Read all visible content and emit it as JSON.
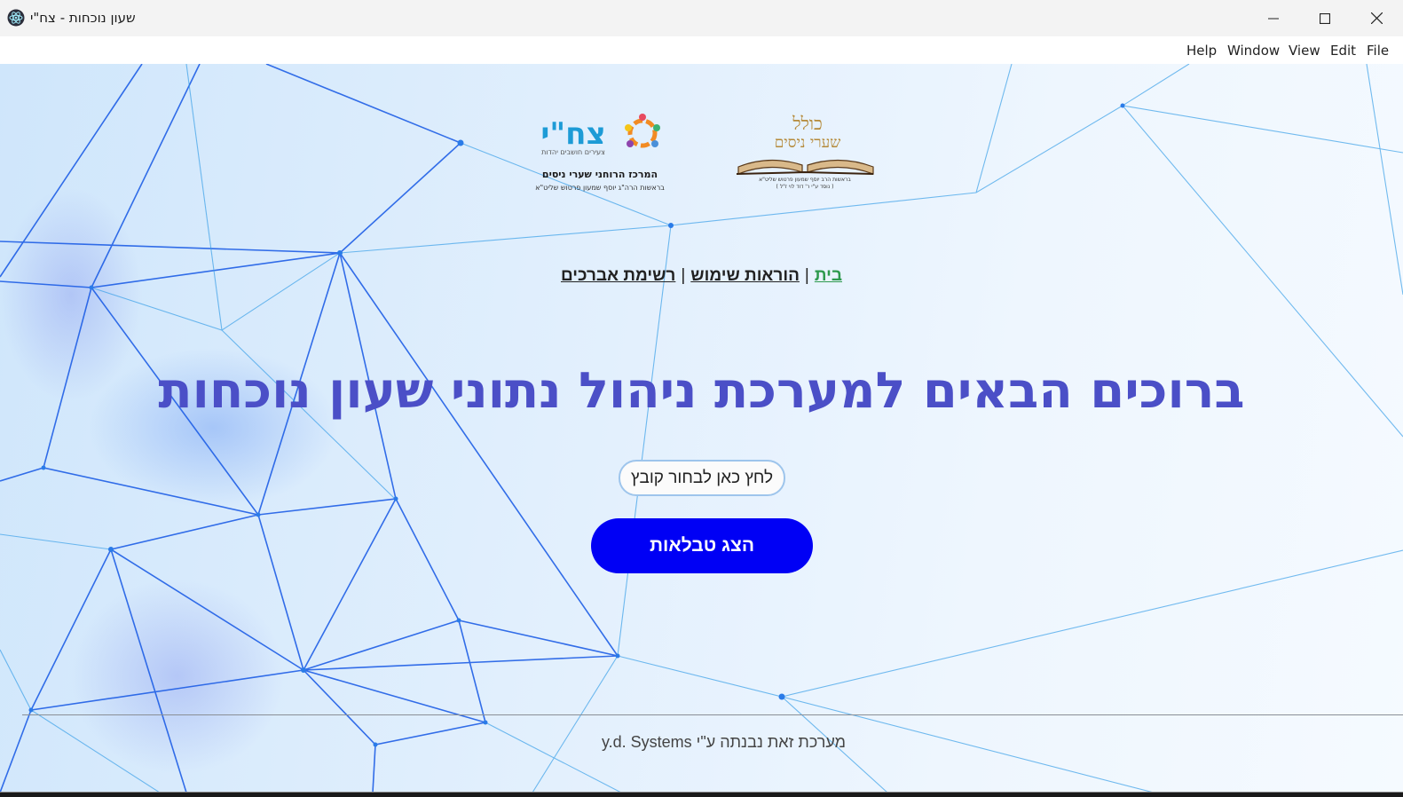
{
  "window": {
    "title": "שעון נוכחות - צח\"י",
    "controls": {
      "minimize": "minimize-icon",
      "maximize": "maximize-icon",
      "close": "close-icon"
    }
  },
  "menu": {
    "file": "File",
    "edit": "Edit",
    "view": "View",
    "window": "Window",
    "help": "Help"
  },
  "logos": {
    "left": {
      "brand": "צח\"י",
      "tagline": "צעירים חושבים יהדות",
      "line1": "המרכז הרוחני שערי ניסים",
      "line2": "בראשות הרה\"ג יוסף שמעון פרטוש שליט\"א"
    },
    "right": {
      "line1": "כולל",
      "line2": "שערי ניסים",
      "line3": "בראשות הרב יוסף שמעון פרטוש שליט\"א",
      "line4": "( נוסד ע\"י ר' דוד לוי ז\"ל )"
    }
  },
  "nav": {
    "home": "בית",
    "instructions": "הוראות שימוש",
    "list": "רשימת אברכים",
    "separator": "|"
  },
  "heading": "ברוכים הבאים למערכת ניהול נתוני שעון נוכחות",
  "buttons": {
    "choose_file": "לחץ כאן לבחור קובץ",
    "show_tables": "הצג טבלאות"
  },
  "footer": "מערכת זאת נבנתה ע\"י y.d. Systems",
  "colors": {
    "heading": "#4b4fc7",
    "primary_button": "#0000f5",
    "nav_active": "#2e9a4e"
  }
}
